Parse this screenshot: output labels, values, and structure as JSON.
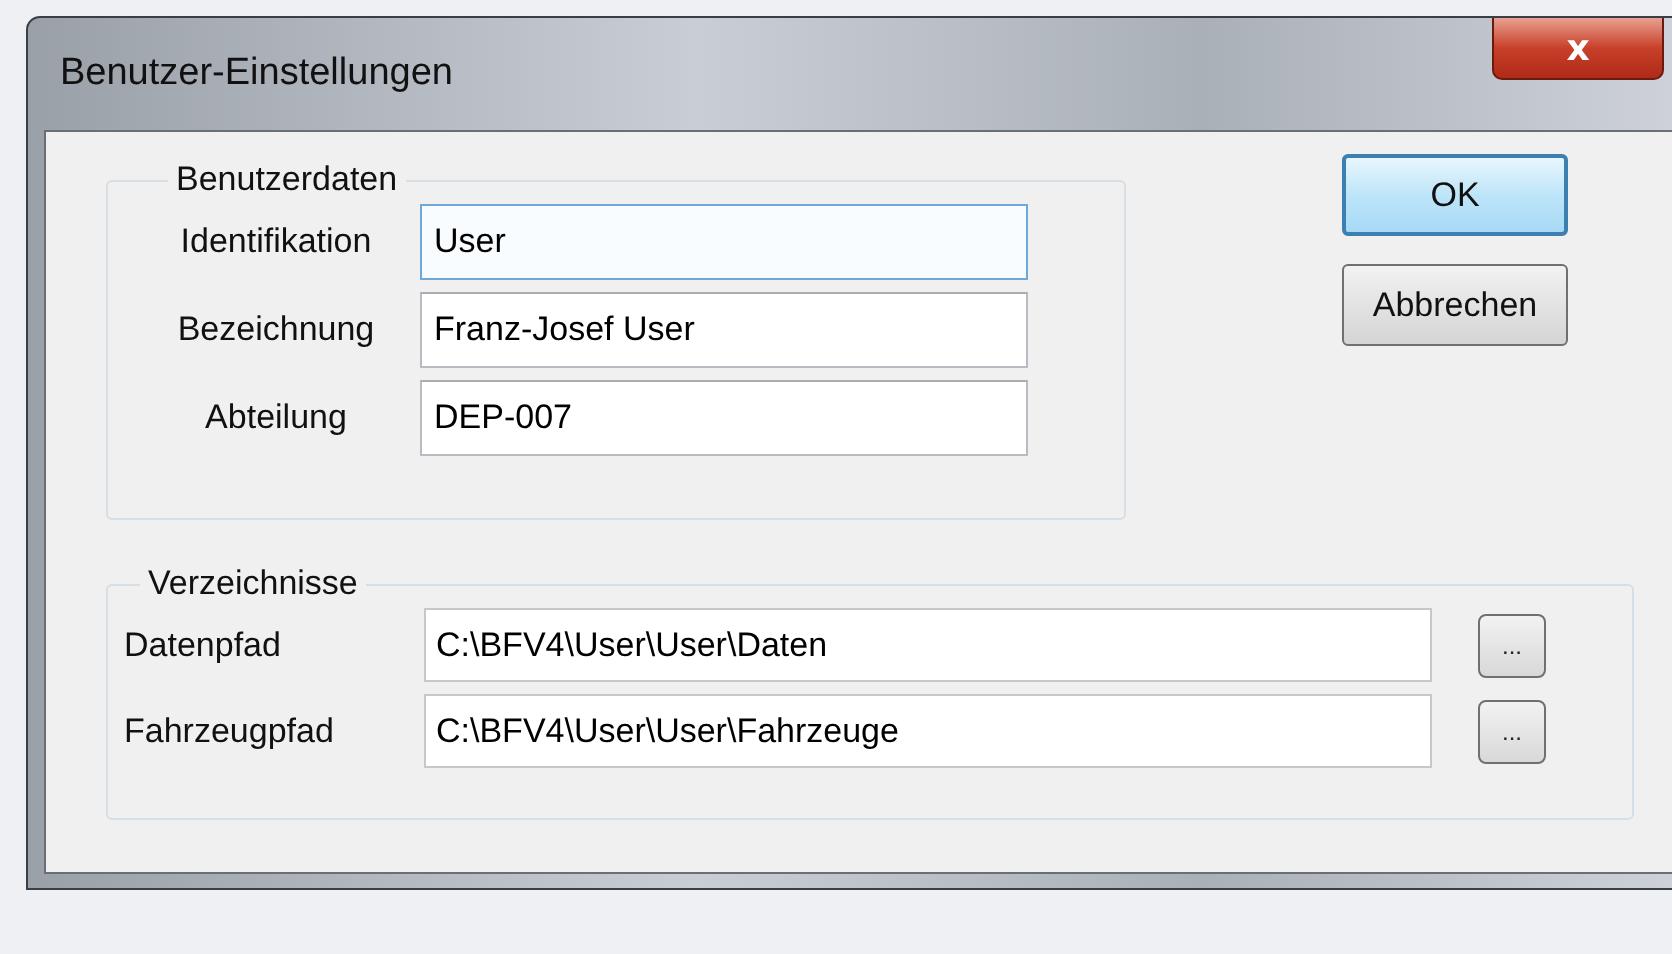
{
  "window": {
    "title": "Benutzer-Einstellungen",
    "close_label": "x"
  },
  "benutzerdaten": {
    "title": "Benutzerdaten",
    "fields": [
      {
        "label": "Identifikation",
        "value": "User",
        "focused": true
      },
      {
        "label": "Bezeichnung",
        "value": "Franz-Josef User",
        "focused": false
      },
      {
        "label": "Abteilung",
        "value": "DEP-007",
        "focused": false
      }
    ]
  },
  "buttons": [
    {
      "label": "OK",
      "default": true
    },
    {
      "label": "Abbrechen",
      "default": false
    }
  ],
  "verzeichnisse": {
    "title": "Verzeichnisse",
    "fields": [
      {
        "label": "Datenpfad",
        "value": "C:\\BFV4\\User\\User\\Daten",
        "browse": "..."
      },
      {
        "label": "Fahrzeugpfad",
        "value": "C:\\BFV4\\User\\User\\Fahrzeuge",
        "browse": "..."
      }
    ]
  }
}
